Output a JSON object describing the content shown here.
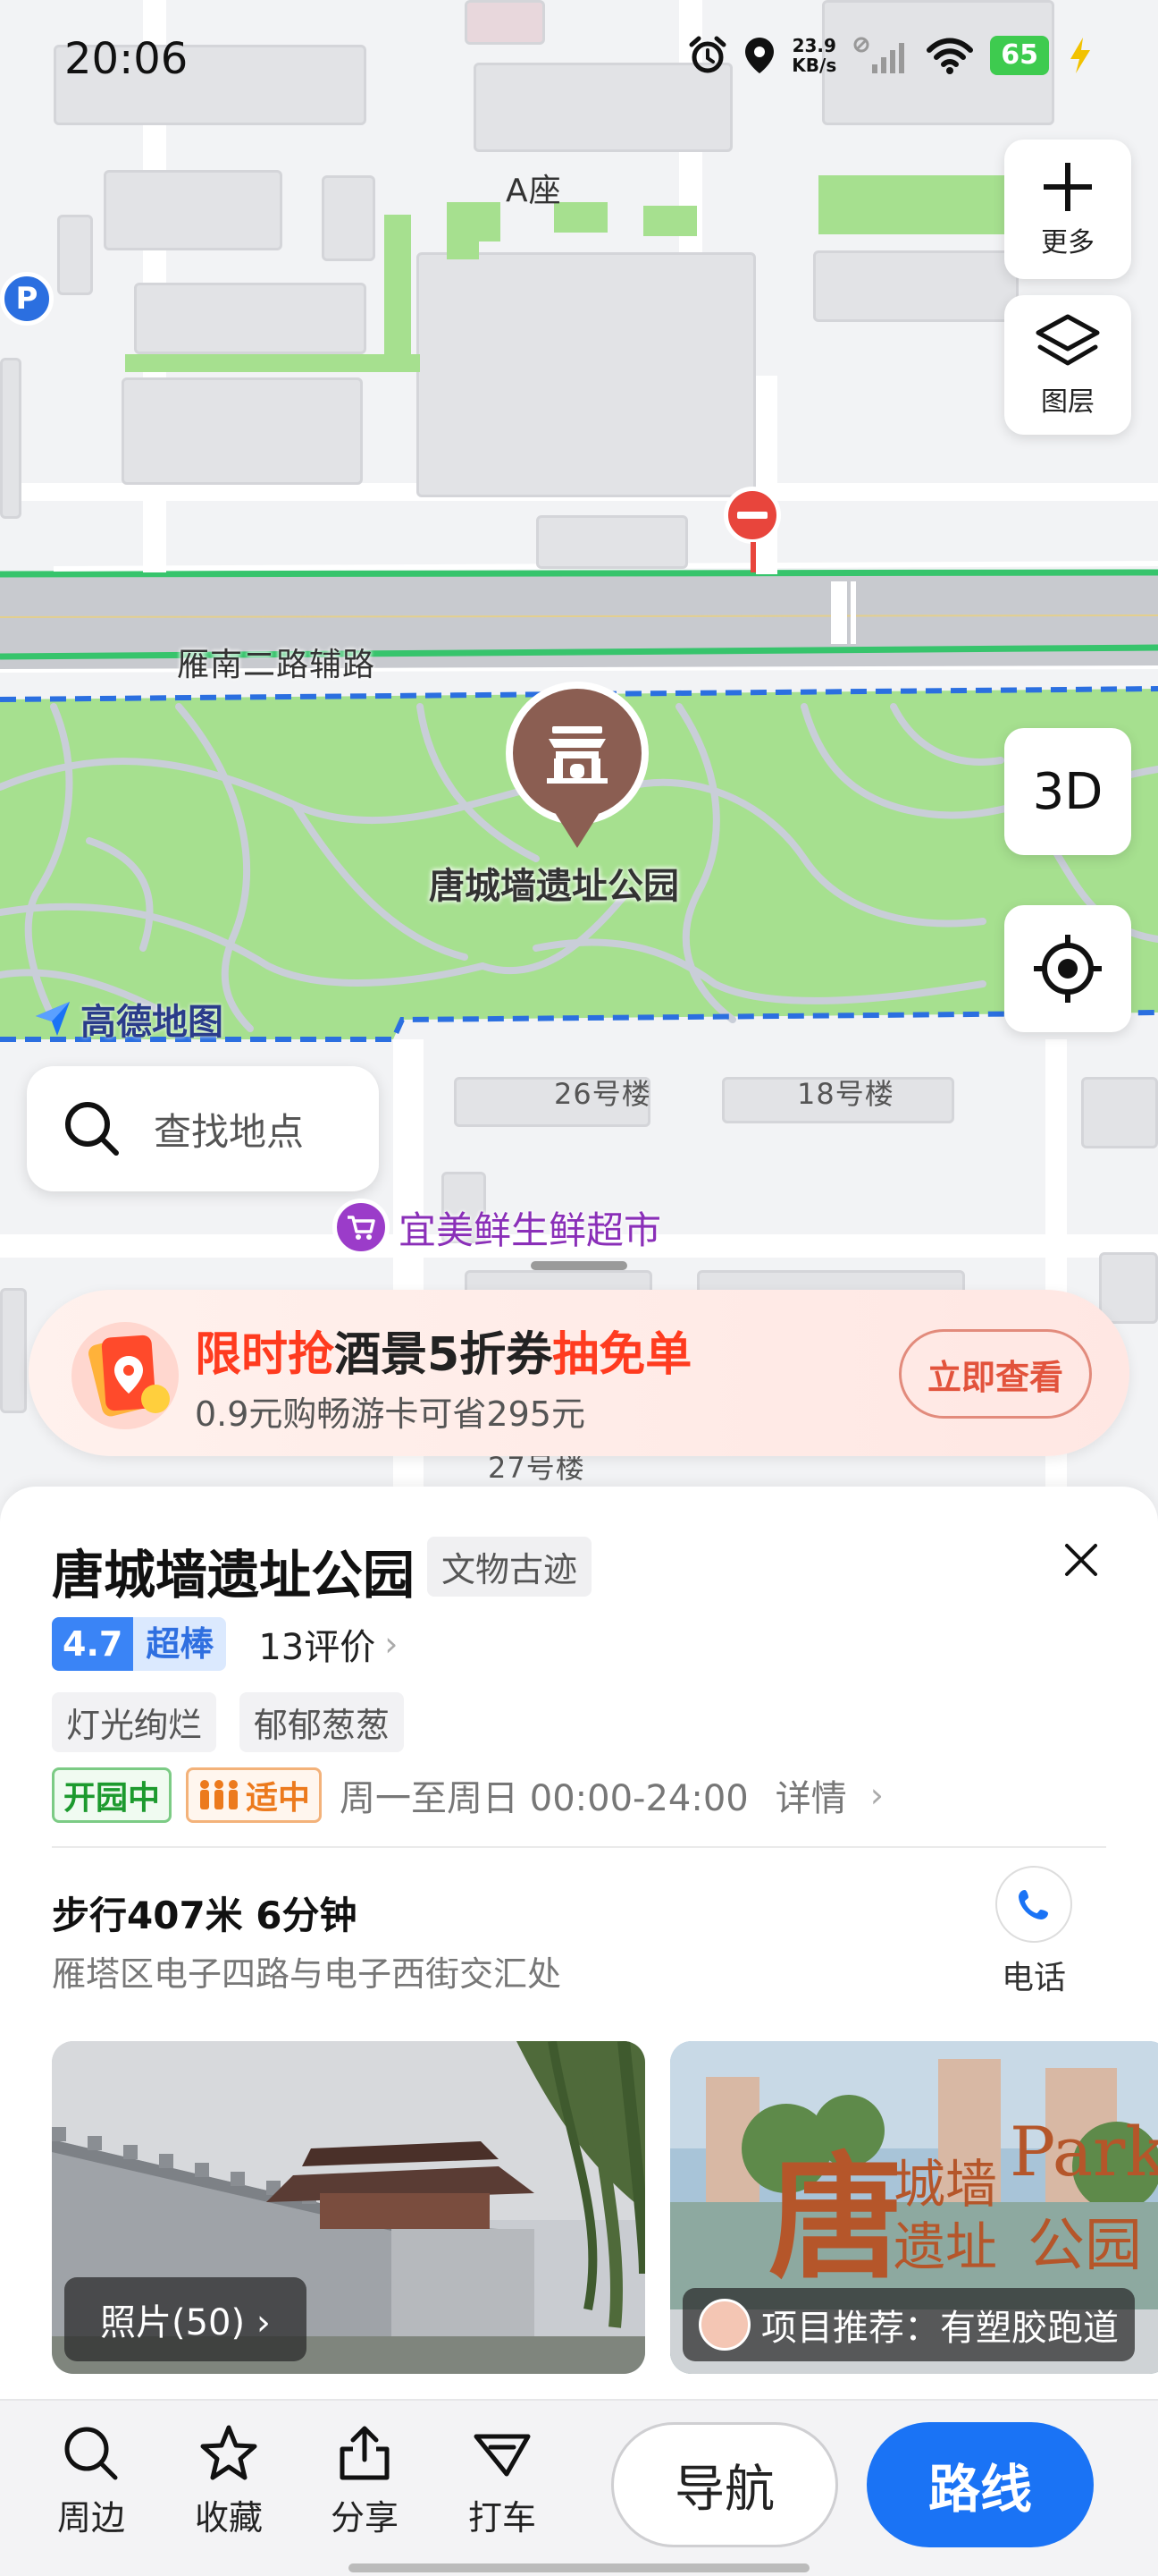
{
  "status_bar": {
    "time": "20:06",
    "net_speed_value": "23.9",
    "net_speed_unit": "KB/s",
    "battery": "65",
    "icons": [
      "alarm-icon",
      "location-icon",
      "mute-icon",
      "signal-icon",
      "wifi-icon",
      "battery-icon",
      "charging-icon"
    ]
  },
  "map": {
    "labels": {
      "building_a": "A座",
      "road": "雁南二路辅路",
      "bldg_26": "26号楼",
      "bldg_18": "18号楼",
      "bldg_27": "27号楼"
    },
    "poi_name": "唐城墙遗址公园",
    "logo_text": "高德地图",
    "search_placeholder": "查找地点",
    "market_name": "宜美鲜生鲜超市",
    "buttons": {
      "more": "更多",
      "layers": "图层",
      "three_d": "3D"
    }
  },
  "promo": {
    "headline_part1": "限时抢",
    "headline_part2": "酒景5折券",
    "headline_part3": "抽免单",
    "sub": "0.9元购畅游卡可省295元",
    "cta": "立即查看"
  },
  "place": {
    "name": "唐城墙遗址公园",
    "category": "文物古迹",
    "rating": "4.7",
    "rating_word": "超棒",
    "review_count": "13评价",
    "tags": [
      "灯光绚烂",
      "郁郁葱葱"
    ],
    "open_status": "开园中",
    "crowd_status": "适中",
    "hours": "周一至周日 00:00-24:00",
    "details": "详情",
    "walk_info": "步行407米 6分钟",
    "address": "雁塔区电子四路与电子西街交汇处",
    "phone_label": "电话",
    "photos_label": "照片(50)",
    "recommend_label": "项目推荐：有塑胶跑道"
  },
  "bottom_bar": {
    "nearby": "周边",
    "favorite": "收藏",
    "share": "分享",
    "taxi": "打车",
    "navigate": "导航",
    "route": "路线"
  },
  "colors": {
    "accent_blue": "#1a73f5",
    "rating_blue": "#3a84f6",
    "promo_red": "#ff3b1f",
    "park_green": "#a6e08f",
    "marker_brown": "#8b5e52",
    "market_purple": "#9b3cc9"
  }
}
